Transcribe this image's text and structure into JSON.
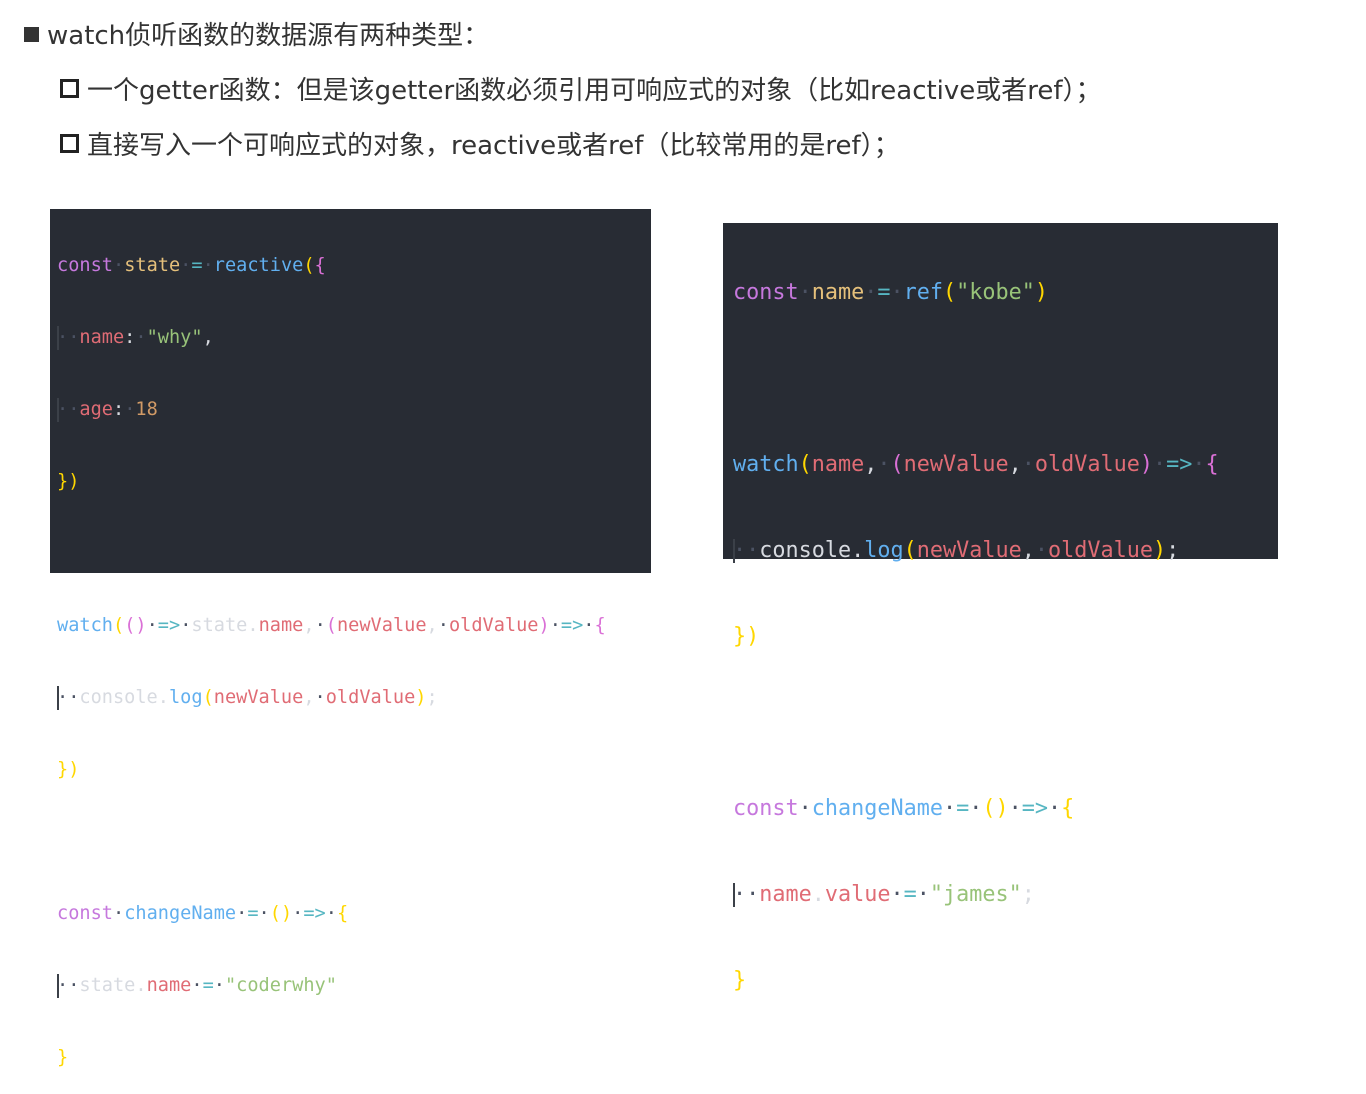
{
  "heading": {
    "text": "watch侦听函数的数据源有两种类型："
  },
  "bullets": [
    {
      "text": "一个getter函数：但是该getter函数必须引用可响应式的对象（比如reactive或者ref）；"
    },
    {
      "text": "直接写入一个可响应式的对象，reactive或者ref（比较常用的是ref）；"
    }
  ],
  "code_left": {
    "lines": [
      "const state = reactive({",
      "  name: \"why\",",
      "  age: 18",
      "})",
      "",
      "watch(() => state.name, (newValue, oldValue) => {",
      "  console.log(newValue, oldValue);",
      "})",
      "",
      "const changeName = () => {",
      "  state.name = \"coderwhy\"",
      "}"
    ]
  },
  "code_right": {
    "lines": [
      "const name = ref(\"kobe\")",
      "",
      "watch(name, (newValue, oldValue) => {",
      "  console.log(newValue, oldValue);",
      "})",
      "",
      "const changeName = () => {",
      "  name.value = \"james\";",
      "}"
    ]
  },
  "colors": {
    "code_background": "#282c34",
    "keyword": "#c678dd",
    "variable": "#e5c07b",
    "operator": "#56b6c2",
    "function": "#61afef",
    "string": "#98c379",
    "number": "#d19a66",
    "property": "#e06c75",
    "bracket_gold": "#ffd700",
    "bracket_purple": "#da70d6"
  },
  "icons": {
    "heading_bullet": "filled-square-icon",
    "item_bullet": "hollow-square-icon"
  }
}
